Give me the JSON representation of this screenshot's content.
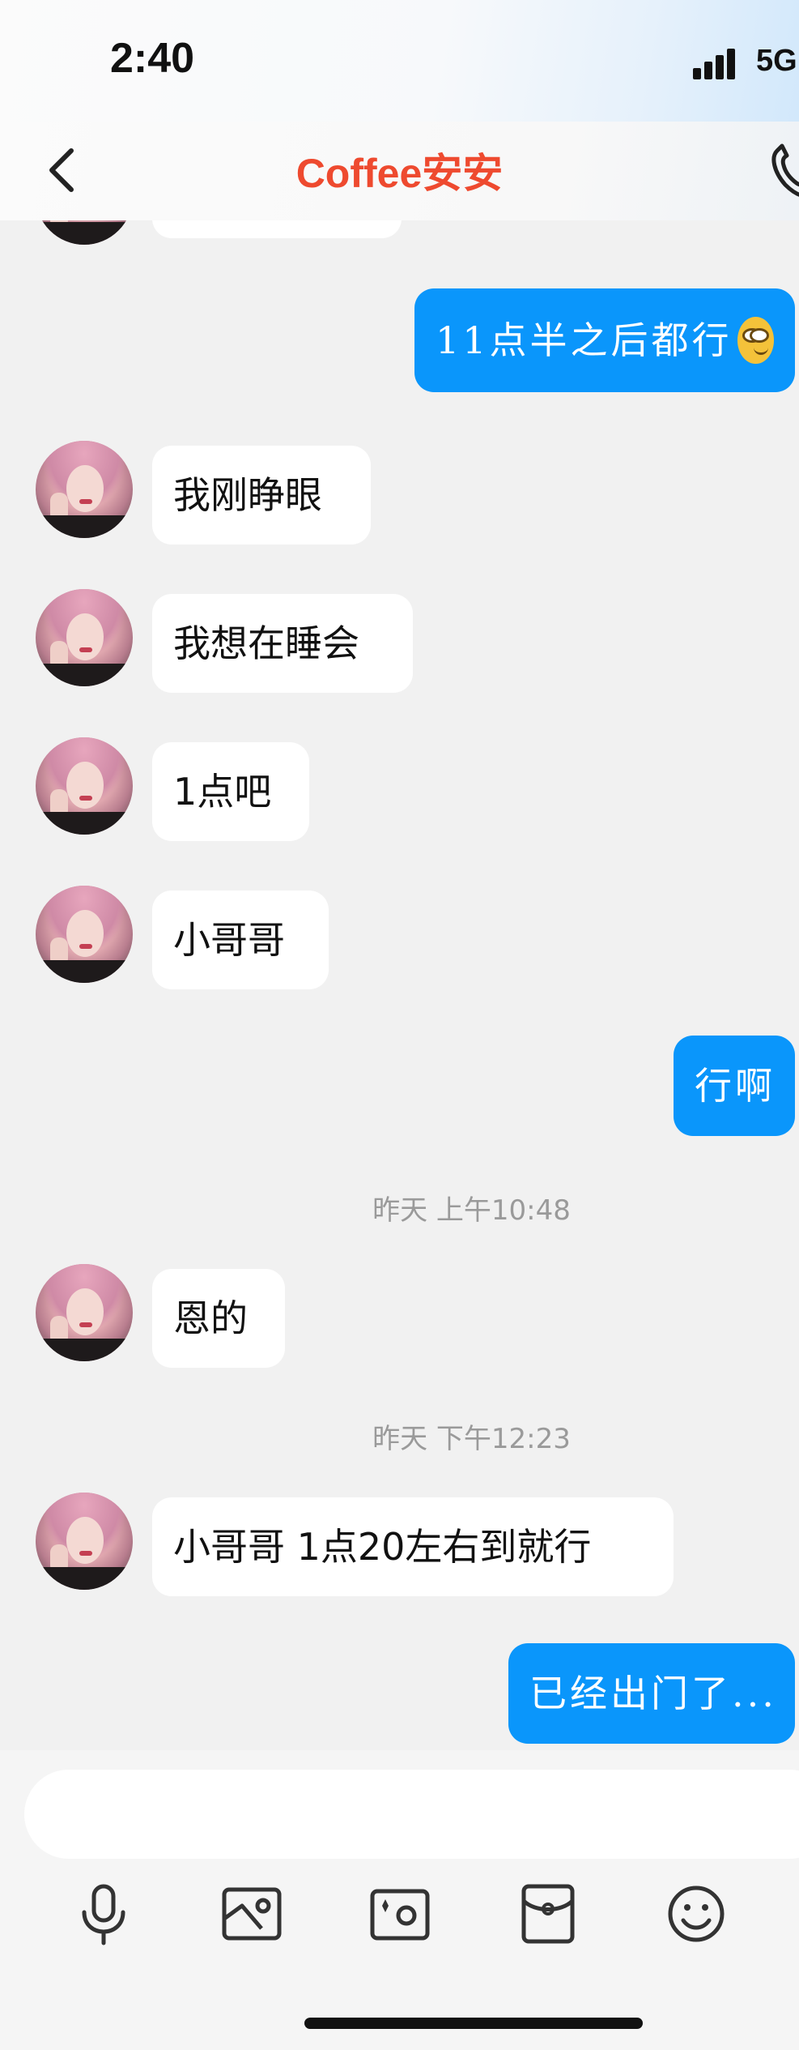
{
  "status_bar": {
    "time": "2:40",
    "network": "5G"
  },
  "nav": {
    "title": "Coffee安安"
  },
  "messages": [
    {
      "side": "out",
      "text": "11点半之后都行"
    },
    {
      "side": "in",
      "text": "我刚睁眼"
    },
    {
      "side": "in",
      "text": "我想在睡会"
    },
    {
      "side": "in",
      "text": "1点吧"
    },
    {
      "side": "in",
      "text": "小哥哥"
    },
    {
      "side": "out",
      "text": "行啊"
    },
    {
      "type": "timestamp",
      "text": "昨天 上午10:48"
    },
    {
      "side": "in",
      "text": "恩的"
    },
    {
      "type": "timestamp",
      "text": "昨天 下午12:23"
    },
    {
      "side": "in",
      "text": "小哥哥 1点20左右到就行"
    },
    {
      "side": "out",
      "text": "已经出门了..."
    }
  ],
  "toolbar": {
    "items": [
      "microphone-icon",
      "photo-icon",
      "camera-icon",
      "red-packet-icon",
      "emoji-icon"
    ]
  },
  "colors": {
    "accent": "#0a96fb",
    "title": "#ee4a2f",
    "background": "#f1f1f1"
  }
}
